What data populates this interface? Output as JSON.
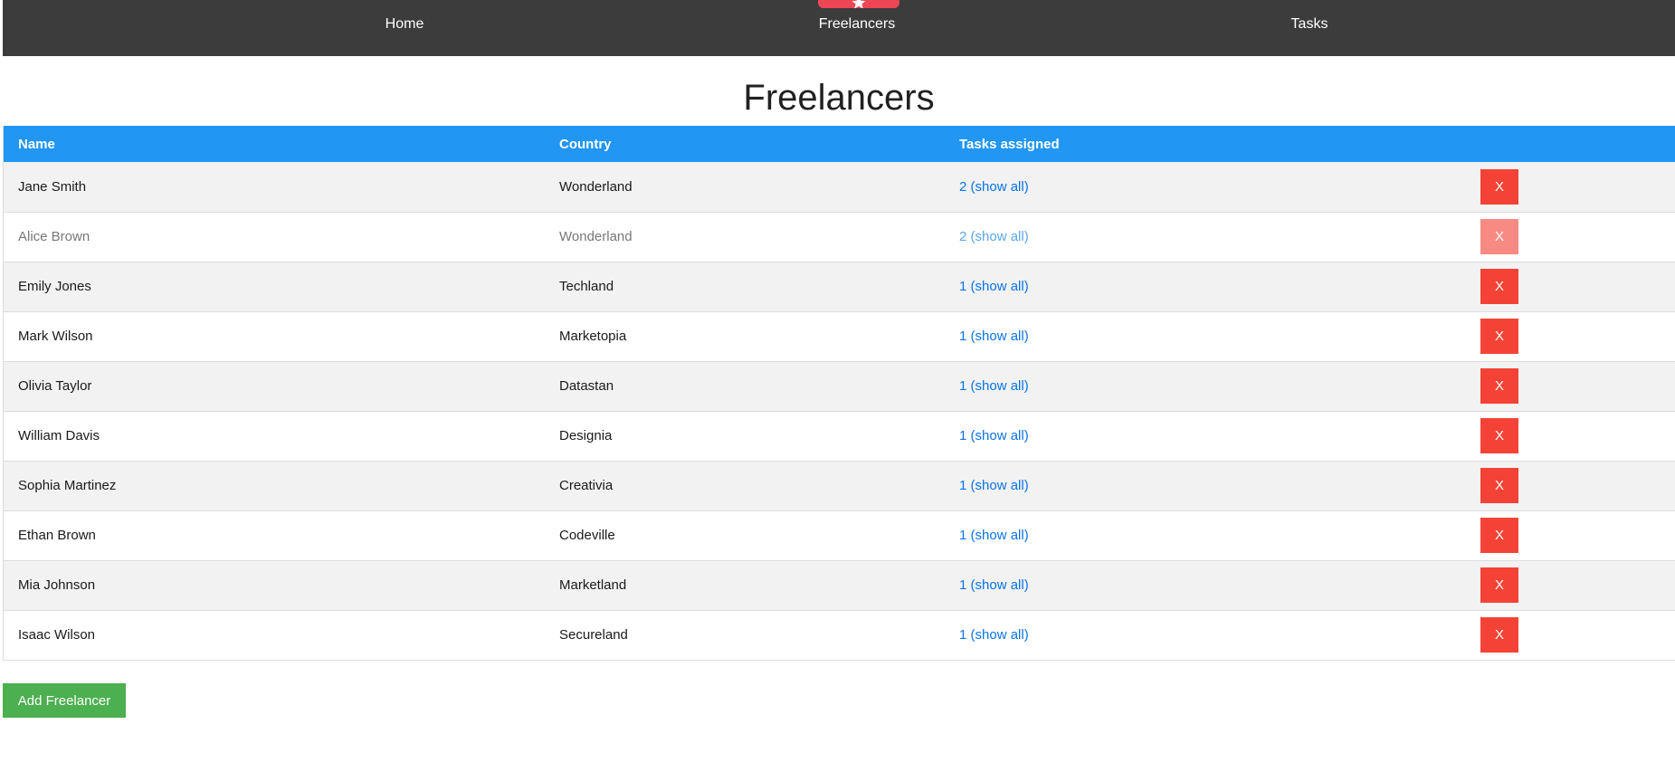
{
  "nav": {
    "items": [
      {
        "label": "Home"
      },
      {
        "label": "Freelancers"
      },
      {
        "label": "Tasks"
      }
    ],
    "active_tab_color": "#ef4656",
    "active_tab_icon": "star-icon"
  },
  "page": {
    "title": "Freelancers"
  },
  "table": {
    "columns": [
      "Name",
      "Country",
      "Tasks assigned",
      ""
    ],
    "delete_label": "X",
    "rows": [
      {
        "name": "Jane Smith",
        "country": "Wonderland",
        "tasks": "2 (show all)",
        "faded": false
      },
      {
        "name": "Alice Brown",
        "country": "Wonderland",
        "tasks": "2 (show all)",
        "faded": true
      },
      {
        "name": "Emily Jones",
        "country": "Techland",
        "tasks": "1 (show all)",
        "faded": false
      },
      {
        "name": "Mark Wilson",
        "country": "Marketopia",
        "tasks": "1 (show all)",
        "faded": false
      },
      {
        "name": "Olivia Taylor",
        "country": "Datastan",
        "tasks": "1 (show all)",
        "faded": false
      },
      {
        "name": "William Davis",
        "country": "Designia",
        "tasks": "1 (show all)",
        "faded": false
      },
      {
        "name": "Sophia Martinez",
        "country": "Creativia",
        "tasks": "1 (show all)",
        "faded": false
      },
      {
        "name": "Ethan Brown",
        "country": "Codeville",
        "tasks": "1 (show all)",
        "faded": false
      },
      {
        "name": "Mia Johnson",
        "country": "Marketland",
        "tasks": "1 (show all)",
        "faded": false
      },
      {
        "name": "Isaac Wilson",
        "country": "Secureland",
        "tasks": "1 (show all)",
        "faded": false
      }
    ]
  },
  "actions": {
    "add_label": "Add Freelancer"
  },
  "colors": {
    "navbar": "#3c3c3c",
    "table_header": "#2196f3",
    "delete": "#f44336",
    "add": "#4caf50",
    "link": "#0a74e8"
  }
}
